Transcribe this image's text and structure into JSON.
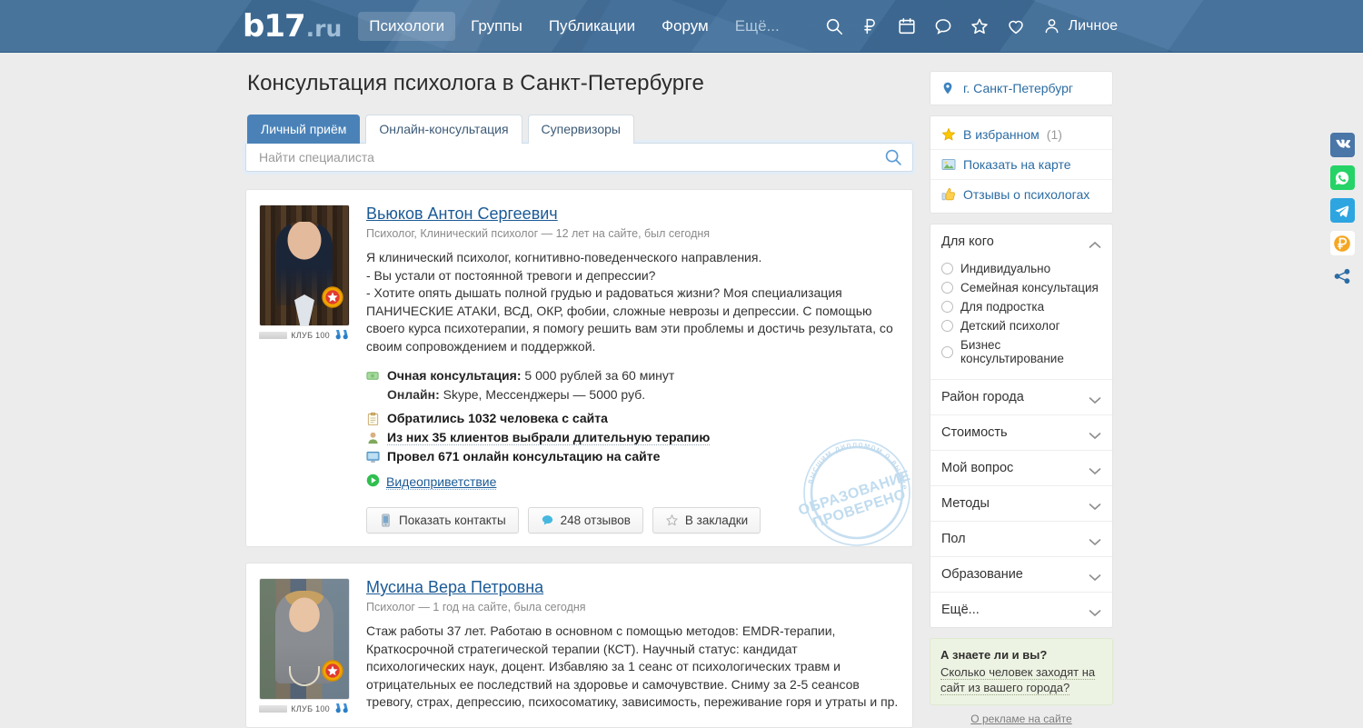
{
  "header": {
    "logo": {
      "main": "b17",
      "suffix": ".ru"
    },
    "nav": [
      {
        "label": "Психологи",
        "active": true
      },
      {
        "label": "Группы",
        "active": false
      },
      {
        "label": "Публикации",
        "active": false
      },
      {
        "label": "Форум",
        "active": false
      },
      {
        "label": "Ещё...",
        "active": false,
        "dim": true
      }
    ],
    "icons": [
      "search-icon",
      "ruble-icon",
      "calendar-icon",
      "comment-icon",
      "star-icon",
      "heart-icon"
    ],
    "personal_label": "Личное",
    "bg_color": "#41709c"
  },
  "main": {
    "page_title": "Консультация психолога в Санкт-Петербурге",
    "tabs": [
      {
        "label": "Личный приём",
        "active": true
      },
      {
        "label": "Онлайн-консультация",
        "active": false
      },
      {
        "label": "Супервизоры",
        "active": false
      }
    ],
    "search": {
      "value": "",
      "placeholder": "Найти специалиста"
    },
    "cards": [
      {
        "name": "Вьюков Антон Сергеевич",
        "meta": "Психолог, Клинический психолог — 12 лет на сайте, был сегодня",
        "club_label": "КЛУБ 100",
        "description": [
          "Я клинический психолог, когнитивно-поведенческого направления.",
          "- Вы устали от постоянной тревоги и депрессии?",
          "- Хотите опять дышать полной грудью и радоваться жизни? Моя специализация ПАНИЧЕСКИЕ АТАКИ, ВСД, ОКР, фобии, сложные неврозы и депрессии. С помощью своего курса психотерапии, я помогу решить вам эти проблемы и достичь результата, со своим сопровождением и поддержкой."
        ],
        "price_label": "Очная консультация:",
        "price_value": "5 000 рублей за 60 минут",
        "online_label": "Онлайн:",
        "online_value": "Skype, Мессенджеры — 5000 руб.",
        "stat_clients": "Обратились 1032 человека с сайта",
        "stat_longterm": "Из них 35 клиентов выбрали длительную терапию",
        "stat_online": "Провел 671 онлайн консультацию на сайте",
        "video_link": "Видеоприветствие",
        "buttons": [
          {
            "label": "Показать контакты",
            "icon": "phone-icon"
          },
          {
            "label": "248 отзывов",
            "icon": "comment-icon"
          },
          {
            "label": "В закладки",
            "icon": "star-icon"
          }
        ],
        "seal_outer": "высшим дипломом о высшем психологическом",
        "seal_line1": "ОБРАЗОВАНИЕ",
        "seal_line2": "ПРОВЕРЕНО"
      },
      {
        "name": "Мусина Вера Петровна",
        "meta": "Психолог — 1 год на сайте, была сегодня",
        "club_label": "КЛУБ 100",
        "description": [
          "Стаж работы 37 лет. Работаю в основном с помощью методов: EMDR-терапии, Краткосрочной стратегической терапии (КСТ). Научный статус: кандидат психологических наук, доцент. Избавляю за 1 сеанс от психологических травм и отрицательных ее последствий на здоровье и самочувствие. Сниму за 2-5 сеансов тревогу, страх, депрессию, психосоматику, зависимость, переживание горя и утраты и пр."
        ]
      }
    ]
  },
  "sidebar": {
    "city": {
      "label": "г. Санкт-Петербург",
      "icon": "map-pin-icon"
    },
    "links": [
      {
        "label": "В избранном",
        "count": "(1)",
        "icon": "star-icon"
      },
      {
        "label": "Показать на карте",
        "count": "",
        "icon": "map-image-icon"
      },
      {
        "label": "Отзывы о психологах",
        "count": "",
        "icon": "thumbs-up-icon"
      }
    ],
    "facets": [
      {
        "label": "Для кого",
        "expanded": true,
        "options": [
          "Индивидуально",
          "Семейная консультация",
          "Для подростка",
          "Детский психолог",
          "Бизнес консультирование"
        ]
      },
      {
        "label": "Район города",
        "expanded": false,
        "options": []
      },
      {
        "label": "Стоимость",
        "expanded": false,
        "options": []
      },
      {
        "label": "Мой вопрос",
        "expanded": false,
        "options": []
      },
      {
        "label": "Методы",
        "expanded": false,
        "options": []
      },
      {
        "label": "Пол",
        "expanded": false,
        "options": []
      },
      {
        "label": "Образование",
        "expanded": false,
        "options": []
      },
      {
        "label": "Ещё...",
        "expanded": false,
        "options": []
      }
    ],
    "promo": {
      "title": "А знаете ли и вы?",
      "text": "Сколько человек заходят на сайт из вашего города?"
    },
    "ads_link": "О рекламе на сайте"
  },
  "social_rail": [
    {
      "name": "vk",
      "glyph": "VK",
      "color": "#4a76a8"
    },
    {
      "name": "whatsapp",
      "glyph": "",
      "color": "#25d366"
    },
    {
      "name": "telegram",
      "glyph": "",
      "color": "#2ca5e0"
    },
    {
      "name": "yandex-money",
      "glyph": "P",
      "color": "#f5a623"
    },
    {
      "name": "share",
      "glyph": "",
      "color": "#2b6ca3"
    }
  ]
}
